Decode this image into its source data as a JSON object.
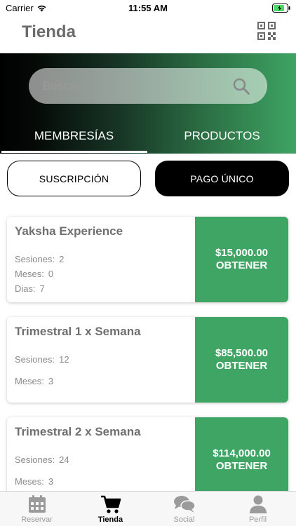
{
  "status_bar": {
    "carrier": "Carrier",
    "time": "11:55 AM"
  },
  "header": {
    "title": "Tienda",
    "qr_icon": "qr-code-icon"
  },
  "search": {
    "placeholder": "Buscar",
    "value": ""
  },
  "tabs": [
    {
      "label": "MEMBRESÍAS",
      "active": true
    },
    {
      "label": "PRODUCTOS",
      "active": false
    }
  ],
  "toggle": {
    "subscription_label": "SUSCRIPCIÓN",
    "one_time_label": "PAGO ÚNICO",
    "selected": "PAGO ÚNICO"
  },
  "memberships": [
    {
      "name": "Yaksha Experience",
      "price": "$15,000.00",
      "action": "OBTENER",
      "details": [
        {
          "label": "Sesiones:",
          "value": "2"
        },
        {
          "label": "Meses:",
          "value": "0"
        },
        {
          "label": "Dias:",
          "value": "7"
        }
      ]
    },
    {
      "name": "Trimestral 1 x Semana",
      "price": "$85,500.00",
      "action": "OBTENER",
      "details": [
        {
          "label": "Sesiones:",
          "value": "12"
        },
        {
          "label": "Meses:",
          "value": "3"
        }
      ]
    },
    {
      "name": "Trimestral 2 x Semana",
      "price": "$114,000.00",
      "action": "OBTENER",
      "details": [
        {
          "label": "Sesiones:",
          "value": "24"
        },
        {
          "label": "Meses:",
          "value": "3"
        }
      ]
    }
  ],
  "bottom_nav": [
    {
      "label": "Reservar",
      "icon": "calendar-icon",
      "active": false
    },
    {
      "label": "Tienda",
      "icon": "shopping-cart-icon",
      "active": true
    },
    {
      "label": "Social",
      "icon": "chat-bubbles-icon",
      "active": false
    },
    {
      "label": "Perfil",
      "icon": "user-icon",
      "active": false
    }
  ],
  "colors": {
    "accent": "#3FA564",
    "dark": "#000000",
    "title_gray": "#6B6B6B"
  }
}
